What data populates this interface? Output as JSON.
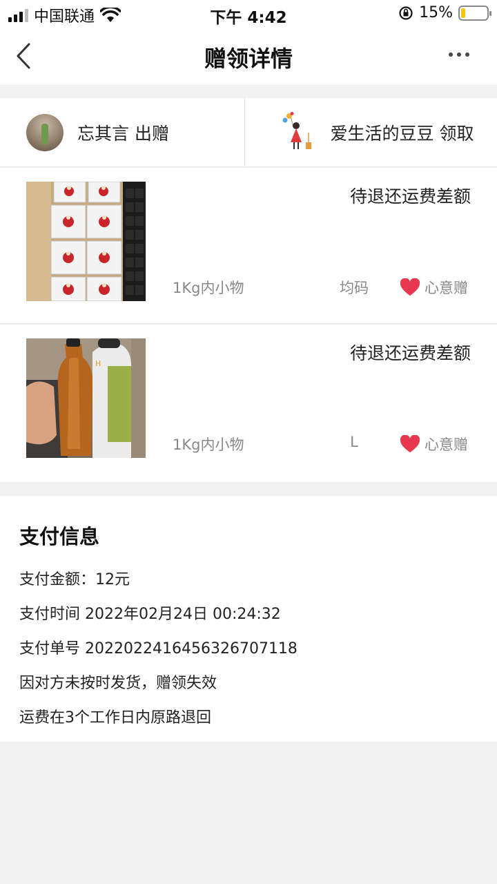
{
  "status_bar": {
    "carrier": "中国联通",
    "time": "下午 4:42",
    "battery": "15%"
  },
  "nav": {
    "title": "赠领详情"
  },
  "parties": {
    "giver": "忘其言 出赠",
    "receiver": "爱生活的豆豆 领取"
  },
  "items": [
    {
      "status": "待退还运费差额",
      "weight": "1Kg内小物",
      "size": "均码",
      "tag": "心意赠",
      "image_icon": "keychain-boxes-photo"
    },
    {
      "status": "待退还运费差额",
      "weight": "1Kg内小物",
      "size": "L",
      "tag": "心意赠",
      "image_icon": "water-bottles-photo"
    }
  ],
  "payment": {
    "title": "支付信息",
    "amount": "支付金额：12元",
    "time": "支付时间 2022年02月24日 00:24:32",
    "order_no": "支付单号 2022022416456326707118",
    "reason": "因对方未按时发货，赠领失效",
    "refund": "运费在3个工作日内原路退回"
  },
  "colors": {
    "heart": "#e8384f",
    "battery_fill": "#f5c518"
  }
}
